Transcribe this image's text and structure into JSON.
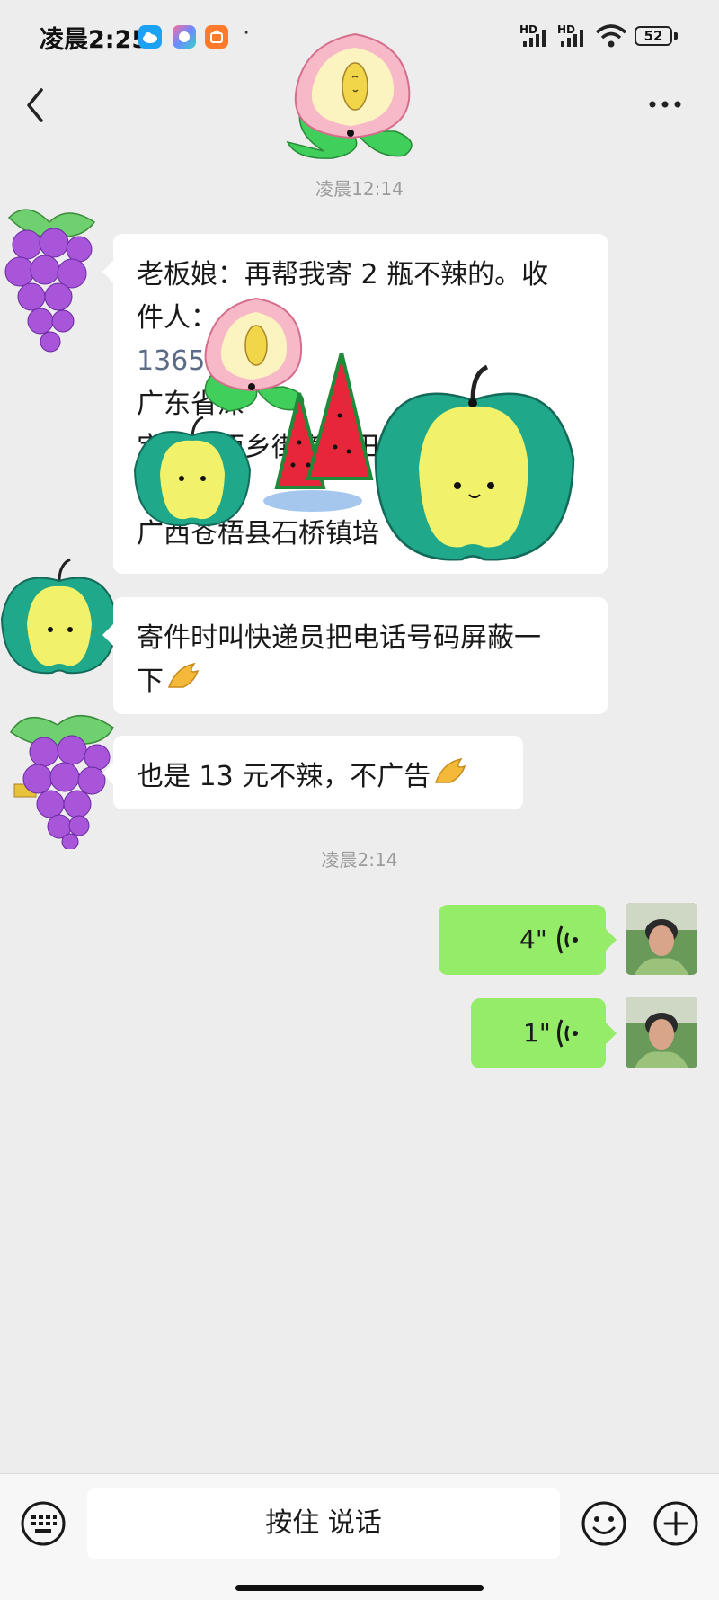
{
  "status_bar": {
    "time": "凌晨2:25",
    "dot": "·",
    "signal_label": "HD",
    "battery": "52"
  },
  "header": {
    "back_icon": "chevron-left-icon",
    "more_icon": "ellipsis-icon"
  },
  "messages": {
    "time_1": "凌晨12:14",
    "msg1_lines": [
      "老板娘：再帮我寄 2 瓶不辣的。收",
      "件人：",
      "1365",
      "广东省深",
      "宝安区西乡街道宝田",
      "广西苍梧县石桥镇培"
    ],
    "msg2_lines": [
      "寄件时叫快递员把电话号码屏蔽一",
      "下"
    ],
    "msg3": "也是 13 元不辣，不广告",
    "time_2": "凌晨2:14",
    "voice1": "4\"",
    "voice2": "1\""
  },
  "input_bar": {
    "talk_label": "按住 说话",
    "keyboard_icon": "keyboard-icon",
    "emoji_icon": "emoji-icon",
    "plus_icon": "plus-icon"
  },
  "colors": {
    "bg": "#ededed",
    "bubble_in": "#ffffff",
    "bubble_out": "#95ec69",
    "timestamp": "#9b9b9b"
  }
}
